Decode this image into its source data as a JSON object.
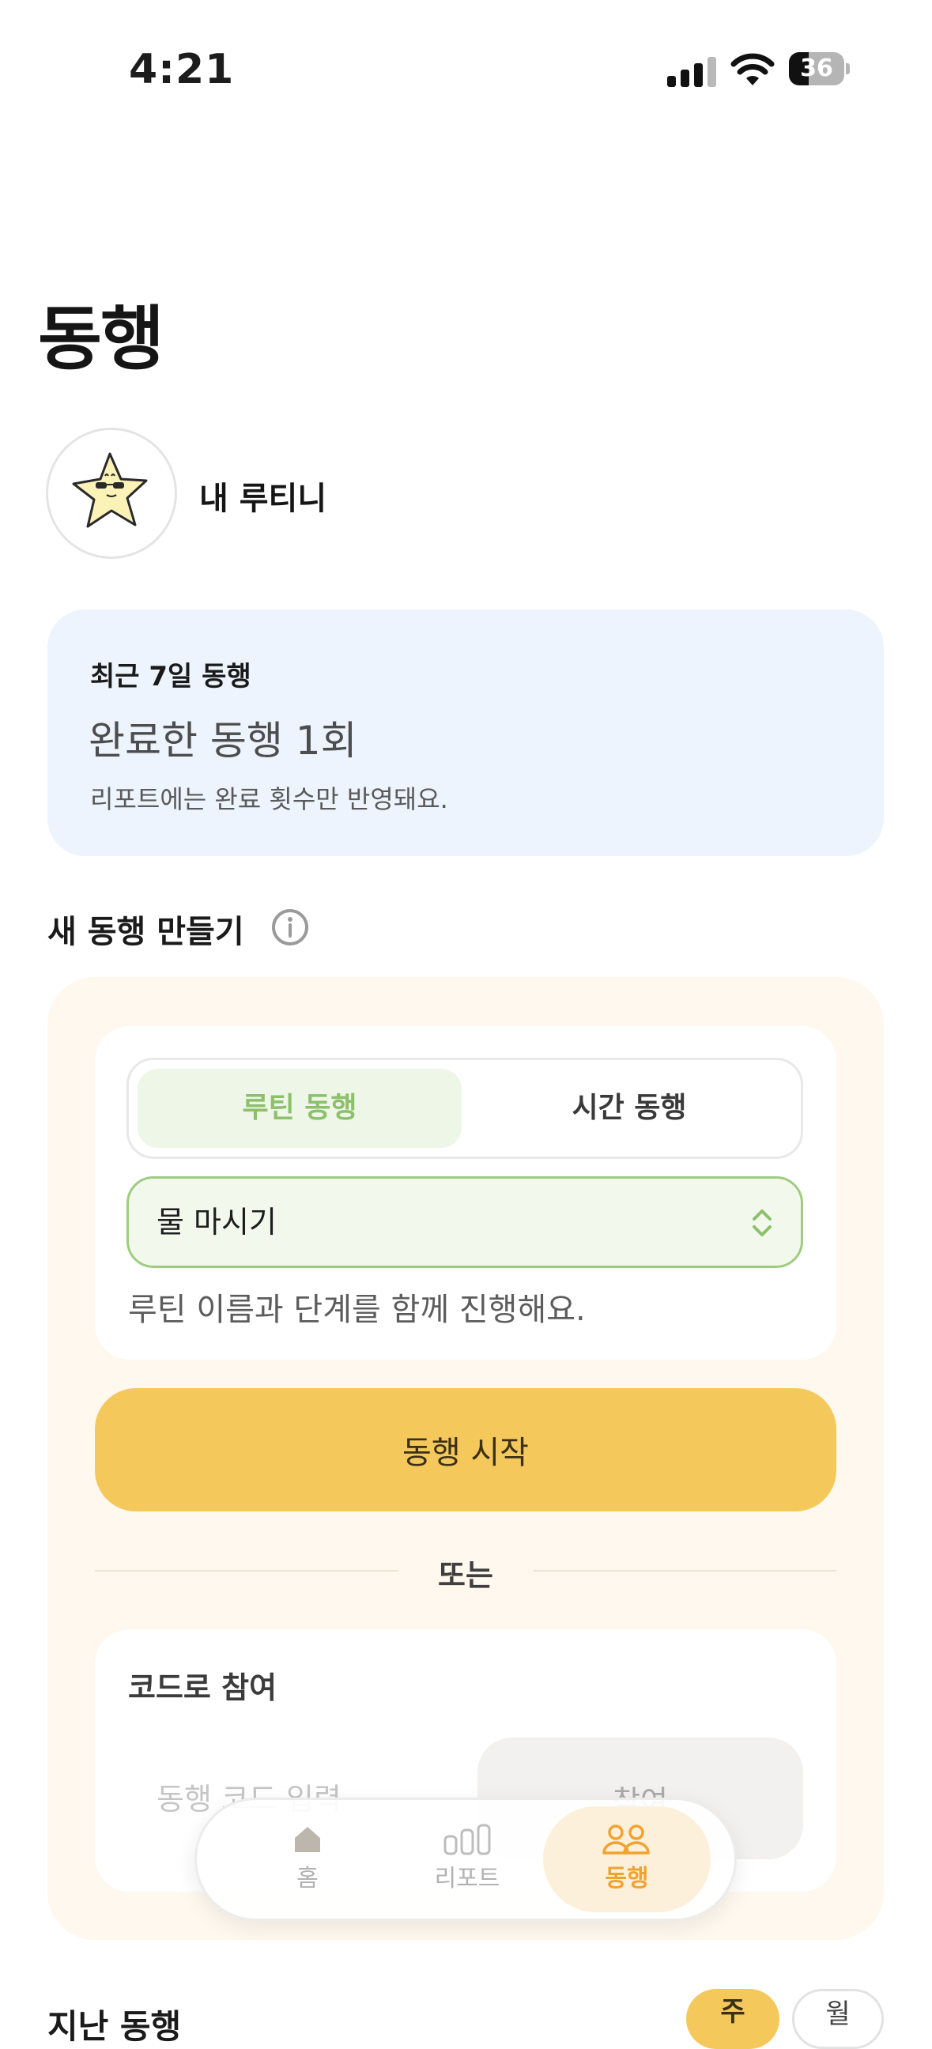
{
  "status_bar": {
    "time": "4:21",
    "battery": "36",
    "battery_level": 0.36
  },
  "page_title": "동행",
  "profile": {
    "routine_name": "내 루티니"
  },
  "stats": {
    "title": "최근 7일 동행",
    "count_text": "완료한 동행 1회",
    "note": "리포트에는 완료 횟수만 반영돼요."
  },
  "create": {
    "section_title": "새 동행 만들기",
    "modes": [
      "루틴 동행",
      "시간 동행"
    ],
    "selected_mode": "루틴 동행",
    "routine_select": "물 마시기",
    "helper": "루틴 이름과 단계를 함께 진행해요.",
    "start_button": "동행 시작",
    "or": "또는"
  },
  "join": {
    "title": "코드로 참여",
    "placeholder": "동행 코드 입력",
    "button": "참여"
  },
  "history": {
    "title": "지난 동행",
    "period_options": [
      "주",
      "월"
    ],
    "selected_period": "주"
  },
  "tabbar": {
    "items": [
      {
        "label": "홈",
        "icon": "home-icon"
      },
      {
        "label": "리포트",
        "icon": "chart-icon"
      },
      {
        "label": "동행",
        "icon": "people-icon"
      }
    ],
    "active": "동행"
  },
  "colors": {
    "accent_yellow": "#f5c85c",
    "accent_green": "#8cc06b",
    "tab_active": "#f0a332",
    "stat_card_bg": "#edf4fd",
    "create_card_bg": "#fef8ee"
  }
}
